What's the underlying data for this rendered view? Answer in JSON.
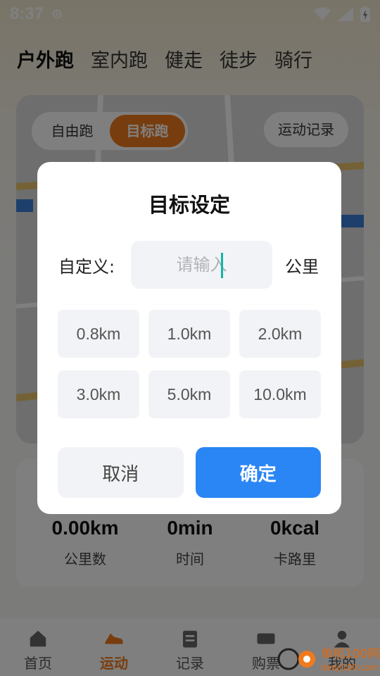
{
  "status_bar": {
    "time": "8:37"
  },
  "sport_tabs": [
    "户外跑",
    "室内跑",
    "健走",
    "徒步",
    "骑行"
  ],
  "mode_switch": {
    "free_run": "自由跑",
    "target_run": "目标跑"
  },
  "records_button": "运动记录",
  "stats": {
    "distance": {
      "value": "0.00km",
      "label": "公里数"
    },
    "time": {
      "value": "0min",
      "label": "时间"
    },
    "calories": {
      "value": "0kcal",
      "label": "卡路里"
    }
  },
  "bottom_nav": [
    "首页",
    "运动",
    "记录",
    "购票",
    "我的"
  ],
  "dialog": {
    "title": "目标设定",
    "custom_label": "自定义:",
    "input_placeholder": "请输入",
    "unit": "公里",
    "options": [
      "0.8km",
      "1.0km",
      "2.0km",
      "3.0km",
      "5.0km",
      "10.0km"
    ],
    "cancel": "取消",
    "confirm": "确定"
  },
  "watermark": {
    "text": "单机100网",
    "url": "danji100.com"
  },
  "colors": {
    "accent_orange": "#f07a1c",
    "confirm_blue": "#2a86f5",
    "overlay": "rgba(0,0,0,0.5)"
  }
}
